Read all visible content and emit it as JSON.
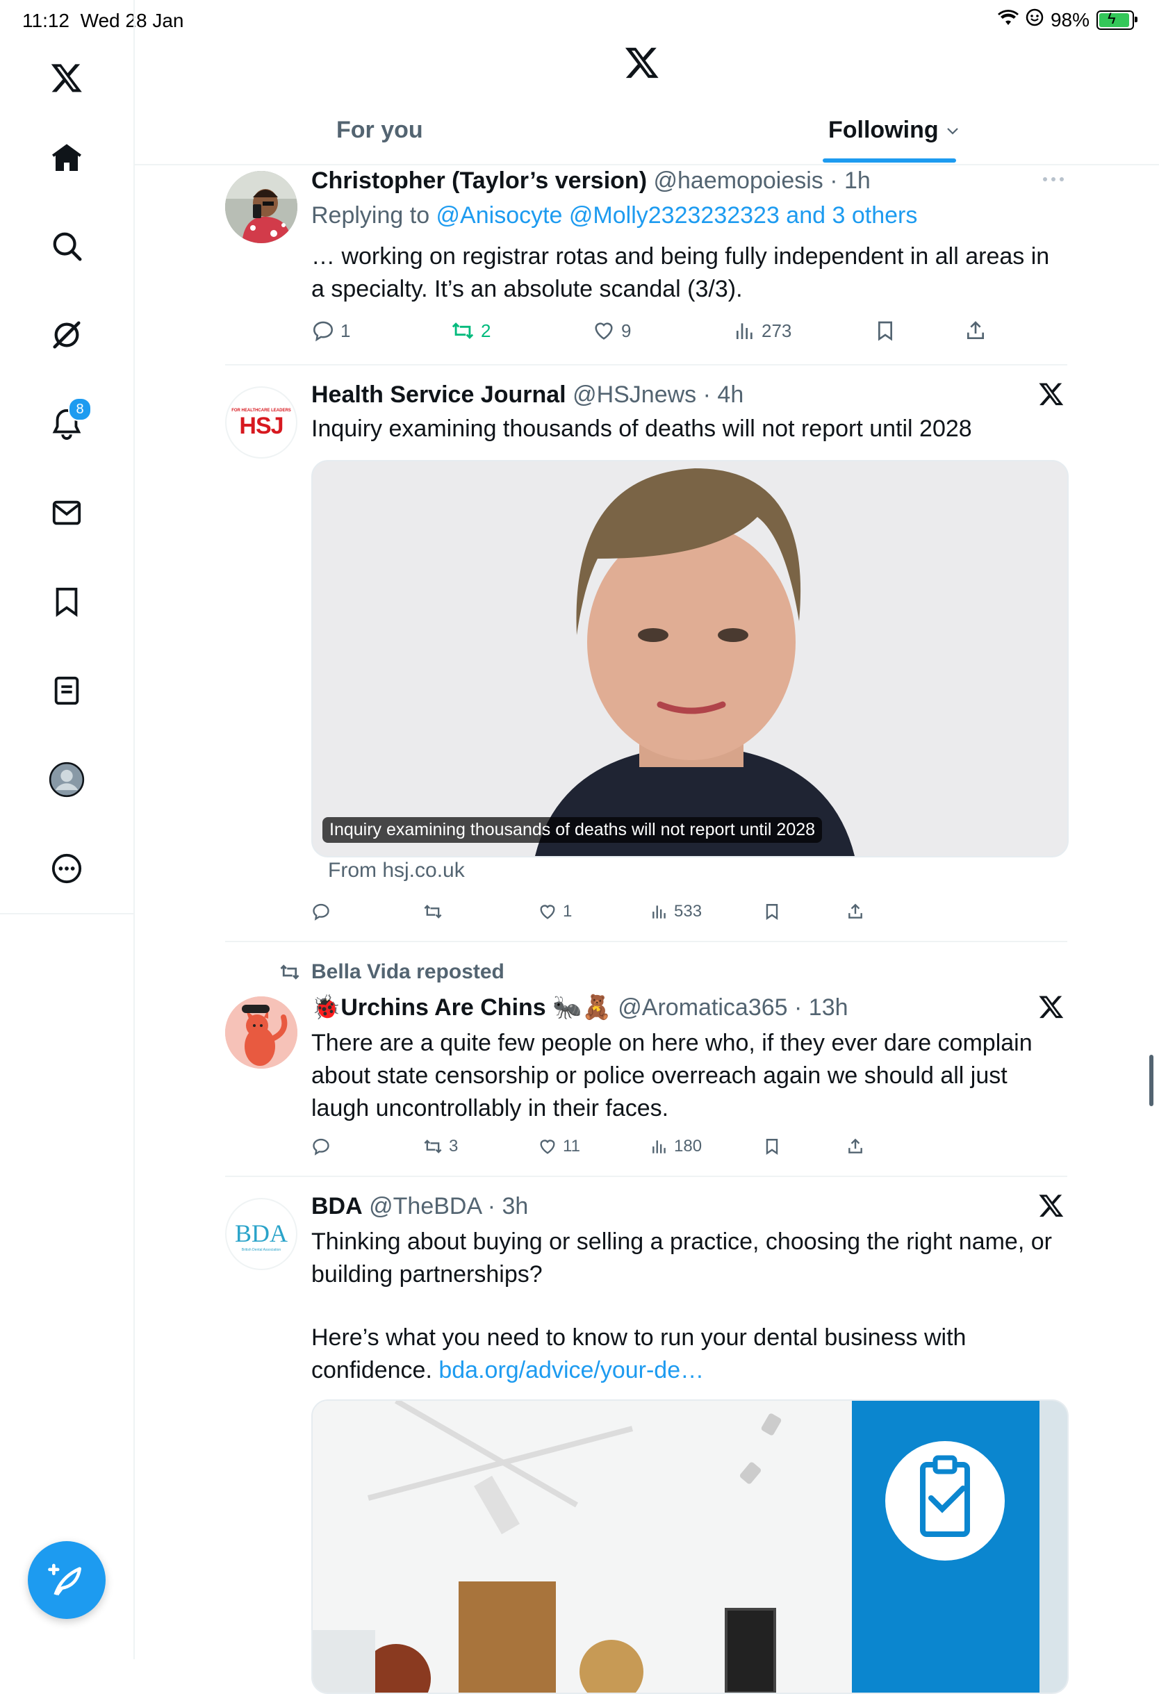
{
  "status": {
    "time": "11:12",
    "date": "Wed 28 Jan",
    "battery": "98%",
    "battery_level": 0.98
  },
  "sidebar": {
    "notifications_badge": "8"
  },
  "tabs": {
    "for_you": "For you",
    "following": "Following"
  },
  "tweets": [
    {
      "name": "Christopher (Taylor’s version)",
      "handle": "@haemopoiesis",
      "time": "1h",
      "replying_prefix": "Replying to ",
      "replying_to": "@Anisocyte @Molly2323232323 and 3 others",
      "text": "… working on registrar rotas and being fully independent in all areas in a specialty. It’s an absolute scandal (3/3).",
      "replies": "1",
      "reposts": "2",
      "likes": "9",
      "views": "273"
    },
    {
      "name": "Health Service Journal",
      "handle": "@HSJnews",
      "time": "4h",
      "avatar_text": "HSJ",
      "avatar_subtext": "FOR HEALTHCARE LEADERS",
      "text": "Inquiry examining thousands of deaths will not report until 2028",
      "media_caption": "Inquiry examining thousands of deaths will not report until 2028",
      "from": "From hsj.co.uk",
      "replies": "",
      "reposts": "",
      "likes": "1",
      "views": "533"
    },
    {
      "reposted_by": "Bella Vida reposted",
      "name_emoji_left": "🐞",
      "name": "Urchins Are Chins",
      "name_emoji_right": "🐜🧸",
      "handle": "@Aromatica365",
      "time": "13h",
      "text": "There are a quite few people on here who, if they ever dare complain about state censorship or police overreach again we should all just laugh uncontrollably in their faces.",
      "replies": "",
      "reposts": "3",
      "likes": "11",
      "views": "180"
    },
    {
      "name": "BDA",
      "handle": "@TheBDA",
      "time": "3h",
      "avatar_text": "BDA",
      "avatar_subtext": "British Dental Association",
      "text1": "Thinking about buying or selling a practice, choosing the right name, or building partnerships?",
      "text2": "Here’s what you need to know to run your dental business with confidence. ",
      "link": "bda.org/advice/your-de…"
    }
  ],
  "colors": {
    "accent": "#1d9bf0",
    "repost_green": "#00ba7c",
    "secondary_text": "#536471",
    "hsj_red": "#d71920"
  }
}
